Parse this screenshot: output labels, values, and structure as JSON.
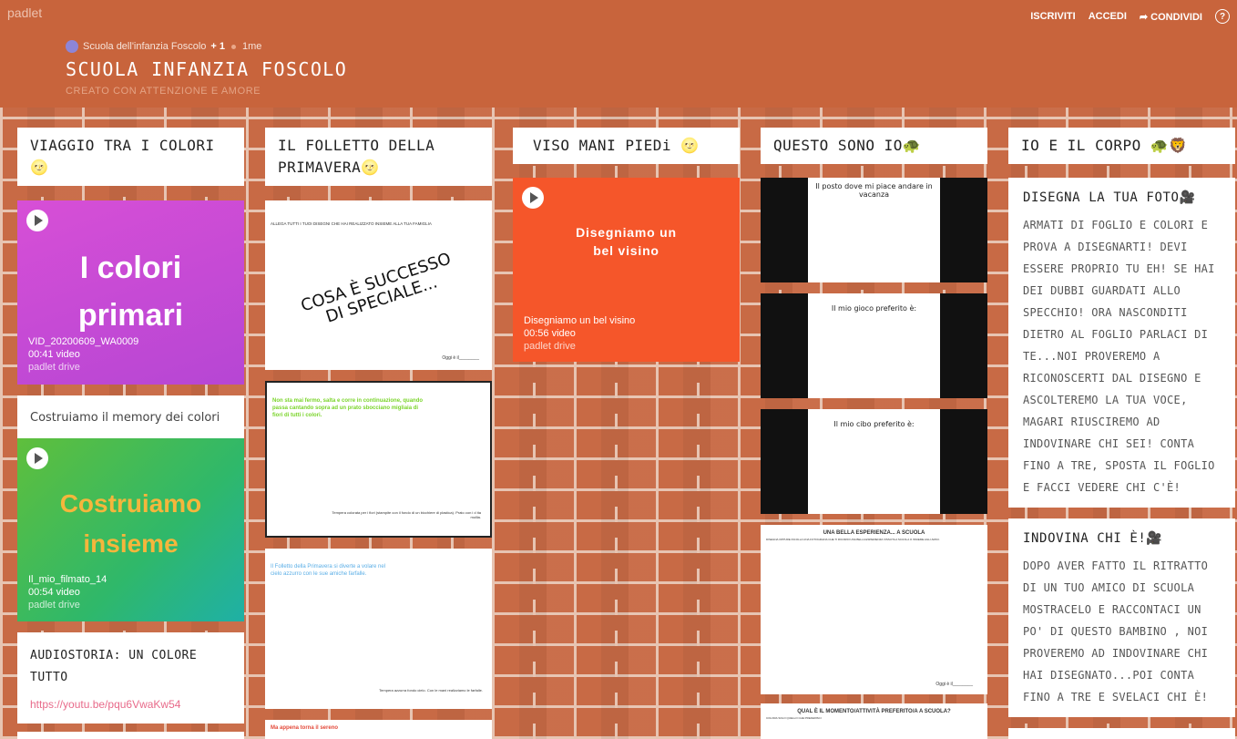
{
  "header": {
    "brand": "padlet",
    "nav": {
      "signup": "ISCRIVITI",
      "login": "ACCEDI",
      "share": "CONDIVIDI",
      "help": "?"
    },
    "author": "Scuola dell'infanzia Foscolo",
    "collaborators": "+ 1",
    "age": "1me",
    "title": "SCUOLA INFANZIA FOSCOLO",
    "subtitle": "CREATO CON ATTENZIONE E AMORE"
  },
  "columns": [
    {
      "title": "VIAGGIO TRA I COLORI🌝"
    },
    {
      "title": "IL FOLLETTO DELLA PRIMAVERA🌝"
    },
    {
      "title": "VISO MANI PIEDi 🌝"
    },
    {
      "title": "QUESTO SONO IO🐢"
    },
    {
      "title": "IO E IL CORPO 🐢🦁"
    }
  ],
  "col1": {
    "video1": {
      "big": "I colori primari",
      "name": "VID_20200609_WA0009",
      "dur": "00:41 video",
      "src": "padlet drive"
    },
    "memory": {
      "caption": "Costruiamo il memory dei colori",
      "big": "Costruiamo insieme",
      "name": "Il_mio_filmato_14",
      "dur": "00:54 video",
      "src": "padlet drive"
    },
    "audio": {
      "title": "AUDIOSTORIA: UN COLORE TUTTO",
      "link": "https://youtu.be/pqu6VwaKw54"
    }
  },
  "col2": {
    "doc1": {
      "head": "ALLEGA TUTTI I TUOI DISEGNI CHE HAI REALIZZATO INSIEME ALLA TUA FAMIGLIA",
      "big": "COSA È SUCCESSO DI SPECIALE...",
      "foot": "Oggi è il________"
    },
    "doc2": {
      "text": "Non sta mai fermo, salta e corre in continuazione, quando passa cantando sopra ad un prato sbocciano migliaia di fiori di tutti i colori.",
      "foot": "Tempera colorata per i fiori (stampite con il fondo di un bicchiere di plastica). Prato con i d ita mollia."
    },
    "doc3": {
      "text": "Il Folletto della Primavera si diverte a volare nel cielo azzurro con le sue amiche farfalle.",
      "foot": "Tempera azzurra fondo cielo. Con le mani realizziamo le farfalle."
    },
    "doc4": {
      "text": "Ma appena torna il sereno"
    }
  },
  "col3": {
    "video": {
      "big": "Disegniamo un bel visino",
      "name": "Disegniamo un bel visino",
      "dur": "00:56 video",
      "src": "padlet drive"
    }
  },
  "col4": {
    "s1": "Il posto dove mi piace andare in vacanza",
    "s2": "Il mio gioco preferito è:",
    "s3": "Il mio cibo preferito è:",
    "s4": {
      "title": "UNA BELLA ESPERIENZA... A SCUOLA",
      "text": "DISEGNA OPPURE INCOLLA UNA FOTOGRAFIA CHE TI RICORDI UNA BELLA ESPERIENZA VISSUTA A SCUOLA O INSIEME AGLI AMICI.",
      "foot": "Oggi è il________"
    },
    "s5": {
      "title": "QUAL È IL MOMENTO/ATTIVITÀ PREFERITO/A A SCUOLA?",
      "text": "COLORA SOLO QUELLO CHE PREFERISCI"
    }
  },
  "col5": {
    "card1": {
      "title": "DISEGNA LA TUA FOTO🎥",
      "body": "ARMATI DI FOGLIO E COLORI E PROVA A DISEGNARTI! DEVI ESSERE PROPRIO TU EH! SE HAI DEI DUBBI GUARDATI ALLO SPECCHIO! ORA NASCONDITI DIETRO AL FOGLIO PARLACI DI TE...NOI PROVEREMO A RICONOSCERTI DAL DISEGNO E ASCOLTEREMO LA TUA VOCE, MAGARI RIUSCIREMO AD INDOVINARE CHI SEI! CONTA FINO A TRE, SPOSTA IL FOGLIO E FACCI VEDERE CHI C'È!"
    },
    "card2": {
      "title": "INDOVINA CHI È!🎥",
      "body": "DOPO AVER FATTO IL RITRATTO DI UN TUO AMICO DI SCUOLA MOSTRACELO E RACCONTACI UN PO' DI QUESTO BAMBINO , NOI PROVEREMO AD INDOVINARE CHI HAI DISEGNATO...POI CONTA FINO A TRE E SVELACI CHI È!"
    }
  },
  "colors": {
    "header": "#c8643c",
    "brick": "#c86a45",
    "mortar": "#e7c4b2",
    "video1": "#c94ad0",
    "memory_green": "#3cba56",
    "memory_text": "#f5b63c",
    "viso": "#f5562a"
  }
}
